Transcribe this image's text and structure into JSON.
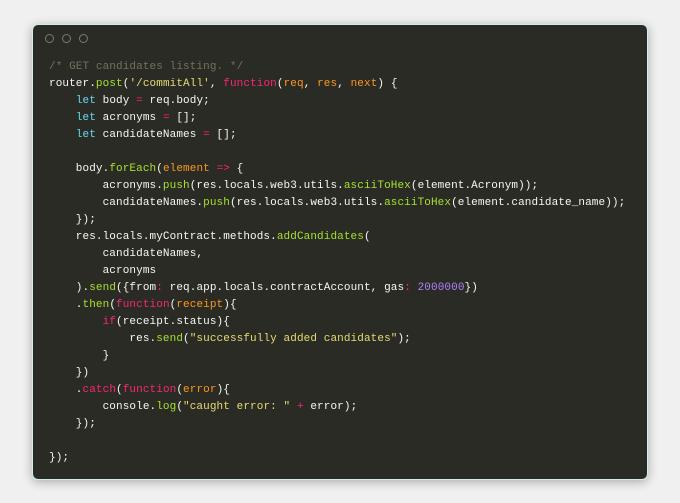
{
  "code": {
    "t": [
      "/* GET candidates listing. */",
      "router",
      ".",
      "post",
      "(",
      "'/commitAll'",
      ", ",
      "function",
      "(",
      "req",
      ", ",
      "res",
      ", ",
      "next",
      ") {",
      "    ",
      "let",
      " body ",
      "=",
      " req.body;",
      "    ",
      "let",
      " acronyms ",
      "=",
      " [];",
      "    ",
      "let",
      " candidateNames ",
      "=",
      " [];",
      "",
      "    body.",
      "forEach",
      "(",
      "element",
      " ",
      "=>",
      " {",
      "        acronyms.",
      "push",
      "(res.locals.web3.utils.",
      "asciiToHex",
      "(element.Acronym));",
      "        candidateNames.",
      "push",
      "(res.locals.web3.utils.",
      "asciiToHex",
      "(element.candidate_name));",
      "    });",
      "    res.locals.myContract.methods.",
      "addCandidates",
      "(",
      "        candidateNames,",
      "        acronyms",
      "    ).",
      "send",
      "({from",
      ":",
      " req.app.locals.contractAccount, gas",
      ":",
      " ",
      "2000000",
      "})",
      "    .",
      "then",
      "(",
      "function",
      "(",
      "receipt",
      "){",
      "        ",
      "if",
      "(receipt.status){",
      "            res.",
      "send",
      "(",
      "\"successfully added candidates\"",
      ");",
      "        }",
      "    })",
      "    .",
      "catch",
      "(",
      "function",
      "(",
      "error",
      "){",
      "        console.",
      "log",
      "(",
      "\"caught error: \"",
      " ",
      "+",
      " error);",
      "    });",
      "",
      "});"
    ]
  }
}
